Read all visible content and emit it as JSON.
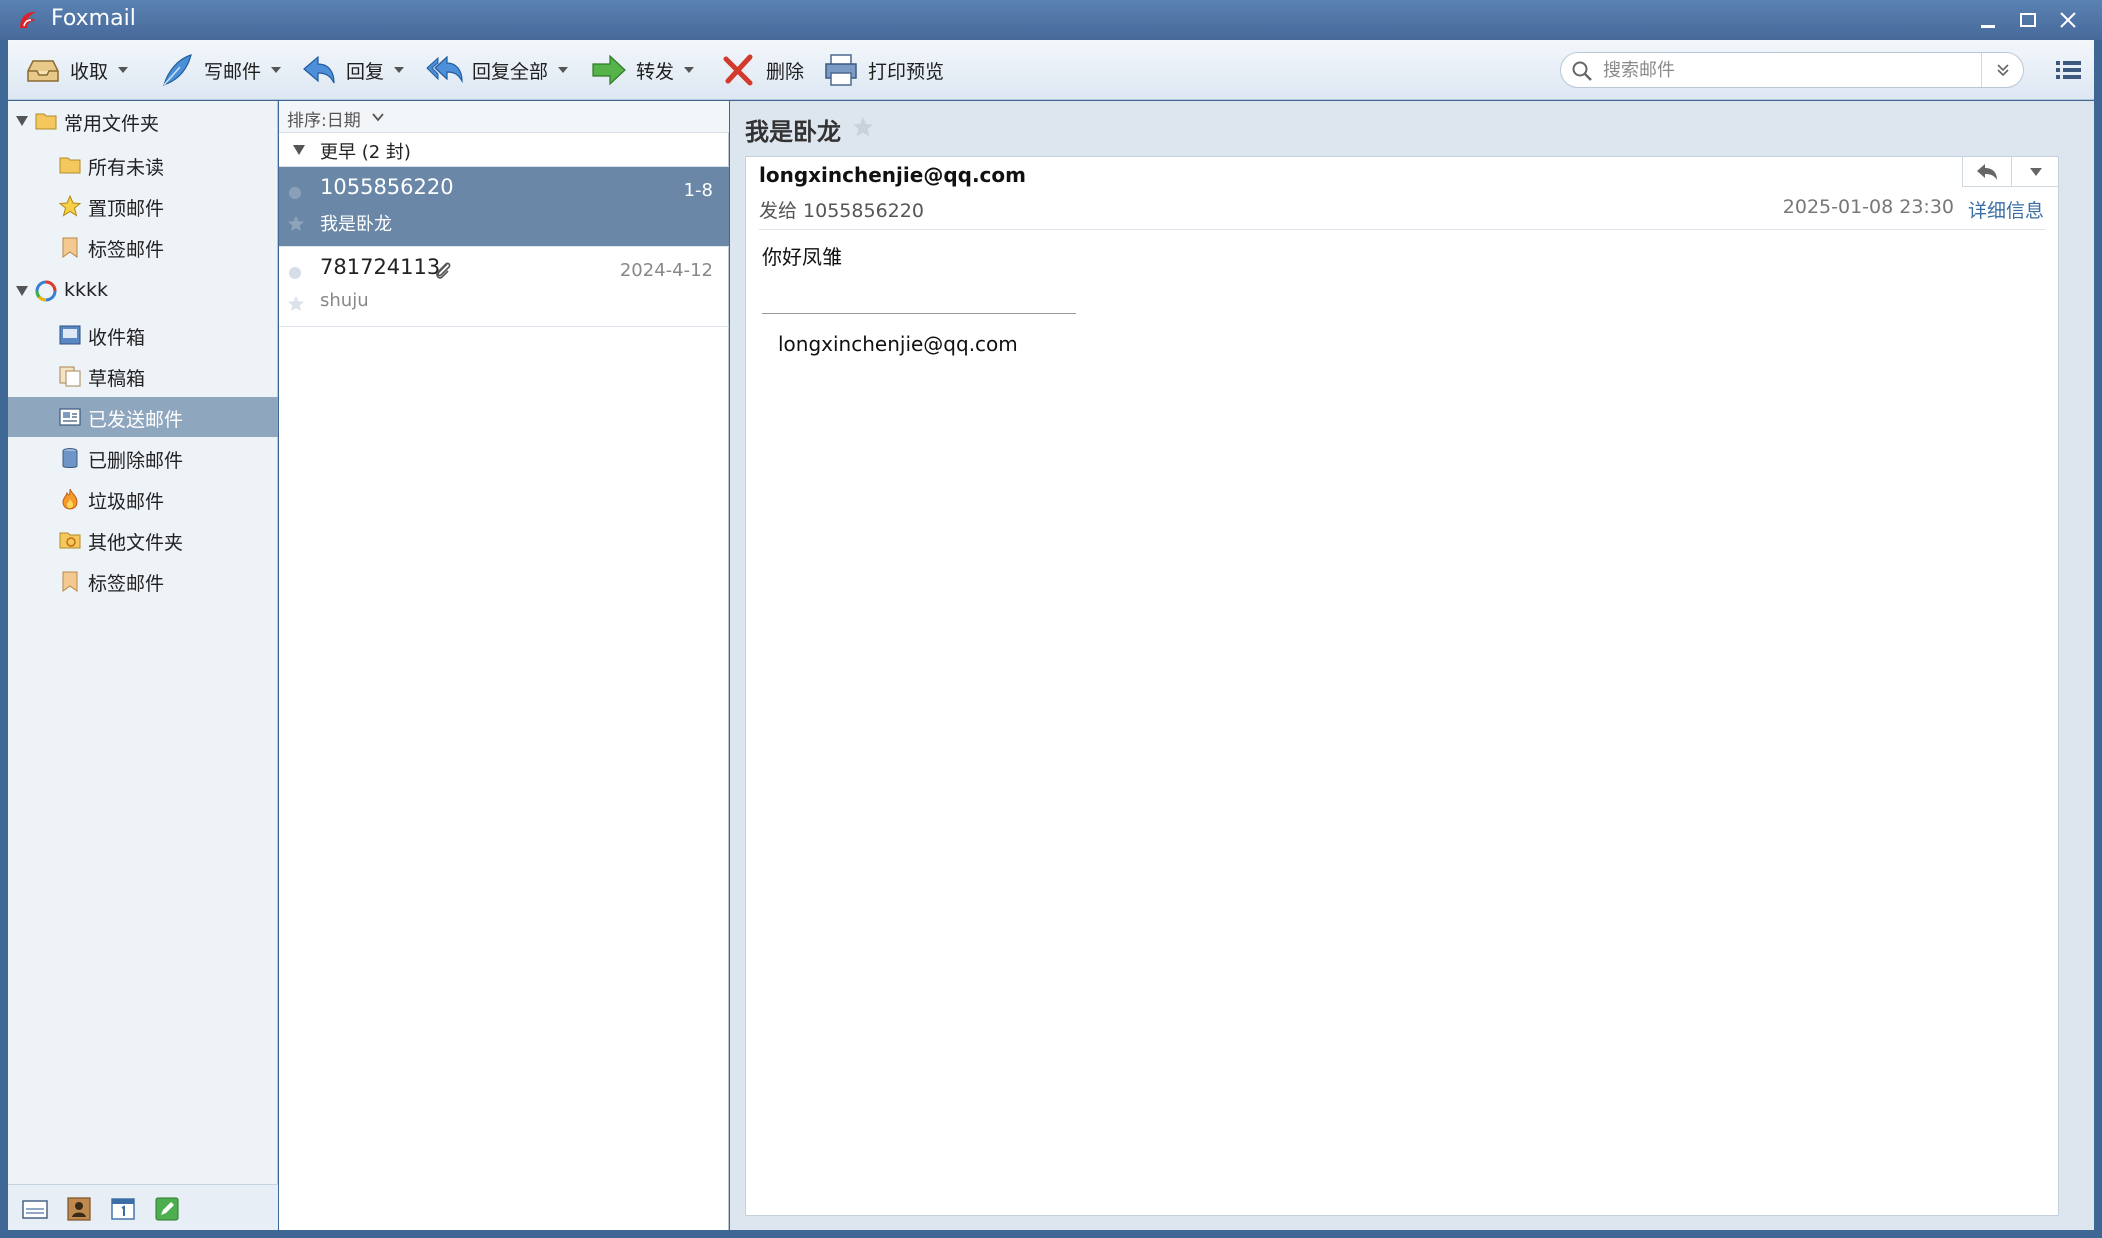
{
  "window": {
    "title": "Foxmail"
  },
  "toolbar": {
    "receive": "收取",
    "compose": "写邮件",
    "reply": "回复",
    "reply_all": "回复全部",
    "forward": "转发",
    "delete": "删除",
    "print_preview": "打印预览",
    "search_placeholder": "搜索邮件"
  },
  "sidebar": {
    "groups": [
      {
        "label": "常用文件夹",
        "items": [
          "所有未读",
          "置顶邮件",
          "标签邮件"
        ]
      },
      {
        "label": "kkkk",
        "items": [
          "收件箱",
          "草稿箱",
          "已发送邮件",
          "已删除邮件",
          "垃圾邮件",
          "其他文件夹",
          "标签邮件"
        ]
      }
    ],
    "selected": "已发送邮件"
  },
  "list": {
    "sort_label": "排序:日期",
    "group_label": "更早 (2 封)",
    "messages": [
      {
        "sender": "1055856220",
        "date": "1-8",
        "subject": "我是卧龙",
        "attachment": false,
        "selected": true
      },
      {
        "sender": "781724113",
        "date": "2024-4-12",
        "subject": "shuju",
        "attachment": true,
        "selected": false
      }
    ]
  },
  "reader": {
    "title": "我是卧龙",
    "from": "longxinchenjie@qq.com",
    "to": "发给 1055856220",
    "datetime": "2025-01-08 23:30",
    "detail_link": "详细信息",
    "body": "你好凤雏",
    "signature": "longxinchenjie@qq.com"
  },
  "colors": {
    "frame": "#3f6796",
    "selection": "#6a87a8",
    "folder_selection": "#8fa6bf",
    "link": "#3b6ea5"
  }
}
